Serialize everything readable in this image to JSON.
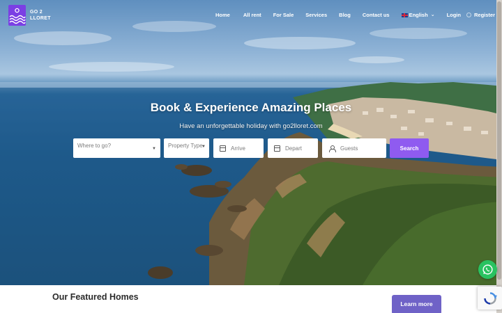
{
  "logo": {
    "line1": "GO 2",
    "line2": "LLORET"
  },
  "nav": {
    "items": [
      "Home",
      "All rent",
      "For Sale",
      "Services",
      "Blog",
      "Contact us"
    ],
    "language": "English",
    "login": "Login",
    "register": "Register"
  },
  "hero": {
    "title": "Book & Experience Amazing Places",
    "subtitle": "Have an unforgettable holiday with go2lloret.com"
  },
  "search": {
    "where_placeholder": "Where to go?",
    "type_placeholder": "Property Type",
    "arrive": "Arrive",
    "depart": "Depart",
    "guests": "Guests",
    "button": "Search"
  },
  "featured": {
    "title": "Our Featured Homes",
    "button": "Learn more"
  },
  "colors": {
    "brand": "#7b3fe4",
    "search_button": "#8f5bf0",
    "learn_button": "#6f62c7",
    "whatsapp": "#29c260"
  },
  "icons": [
    "calendar-icon",
    "person-icon",
    "chevron-down-icon",
    "whatsapp-icon",
    "recaptcha-icon",
    "flag-uk-icon"
  ]
}
